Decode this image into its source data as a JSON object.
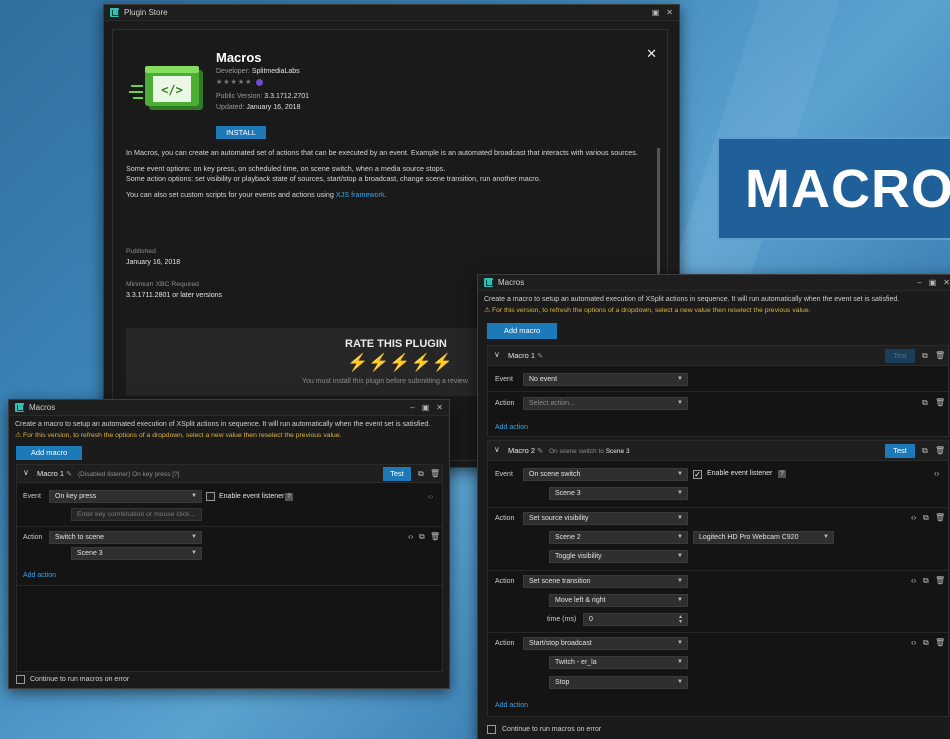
{
  "background": {
    "banner_text": "MACROS"
  },
  "plugin_store": {
    "window_title": "Plugin Store",
    "name": "Macros",
    "developer_label": "Developer:",
    "developer": "SplitmediaLabs",
    "rating_stars": "★★★★★",
    "public_version_label": "Public Version:",
    "public_version": "3.3.1712.2701",
    "updated_label": "Updated:",
    "updated": "January 16, 2018",
    "install_label": "INSTALL",
    "desc_1": "In Macros, you can create an automated set of actions that can be executed by an event. Example is an automated broadcast that interacts with various sources.",
    "desc_2": "Some event options: on key press, on scheduled time, on scene switch, when a media source stops.",
    "desc_3": "Some action options: set visibility or playback state of sources, start/stop a broadcast, change scene transition, run another macro.",
    "desc_4_pre": "You can also set custom scripts for your events and actions using ",
    "desc_4_link": "XJS framework",
    "desc_4_post": ".",
    "published_label": "Published",
    "published": "January 16, 2018",
    "min_label": "Minimum XBC Required",
    "min_value": "3.3.1711.2801 or later versions",
    "rate_title": "RATE THIS PLUGIN",
    "rate_note": "You must install this plugin before submitting a review"
  },
  "macros_small": {
    "window_title": "Macros",
    "desc": "Create a macro to setup an automated execution of XSplit actions in sequence. It will run automatically when the event set is satisfied.",
    "warning": "For this version, to refresh the options of a dropdown, select a new value then reselect the previous value.",
    "add_macro": "Add macro",
    "macro_name": "Macro 1",
    "macro_note": "(Disabled listener) On key press [?]",
    "test": "Test",
    "event_label": "Event",
    "event_value": "On key press",
    "enable_listener": "Enable event listener",
    "key_placeholder": "Enter key combination or mouse click...",
    "action_label": "Action",
    "action_value": "Switch to scene",
    "scene_value": "Scene 3",
    "add_action": "Add action",
    "continue_label": "Continue to run macros on error"
  },
  "macros_large": {
    "window_title": "Macros",
    "desc": "Create a macro to setup an automated execution of XSplit actions in sequence. It will run automatically when the event set is satisfied.",
    "warning": "For this version, to refresh the options of a dropdown, select a new value then reselect the previous value.",
    "add_macro": "Add macro",
    "macro1": {
      "name": "Macro 1",
      "test": "Test",
      "event_label": "Event",
      "event_value": "No event",
      "action_label": "Action",
      "action_placeholder": "Select action...",
      "add_action": "Add action"
    },
    "macro2": {
      "name": "Macro 2",
      "note_pre": "On scene switch to",
      "note_scene": "Scene 3",
      "test": "Test",
      "event_label": "Event",
      "event_value": "On scene switch",
      "enable_listener": "Enable event listener",
      "event_scene": "Scene 3",
      "actions": [
        {
          "label": "Action",
          "value": "Set source visibility",
          "sub1": "Scene 2",
          "sub1b": "Logitech HD Pro Webcam C920",
          "sub2": "Toggle visibility"
        },
        {
          "label": "Action",
          "value": "Set scene transition",
          "sub1": "Move left & right",
          "time_label": "time (ms)",
          "time_value": "0"
        },
        {
          "label": "Action",
          "value": "Start/stop broadcast",
          "sub1": "Twitch - er_la",
          "sub2": "Stop"
        }
      ],
      "add_action": "Add action"
    },
    "continue_label": "Continue to run macros on error"
  },
  "colors": {
    "accent": "#1e79b8",
    "warning": "#e0b341",
    "link": "#3aa4e8"
  }
}
